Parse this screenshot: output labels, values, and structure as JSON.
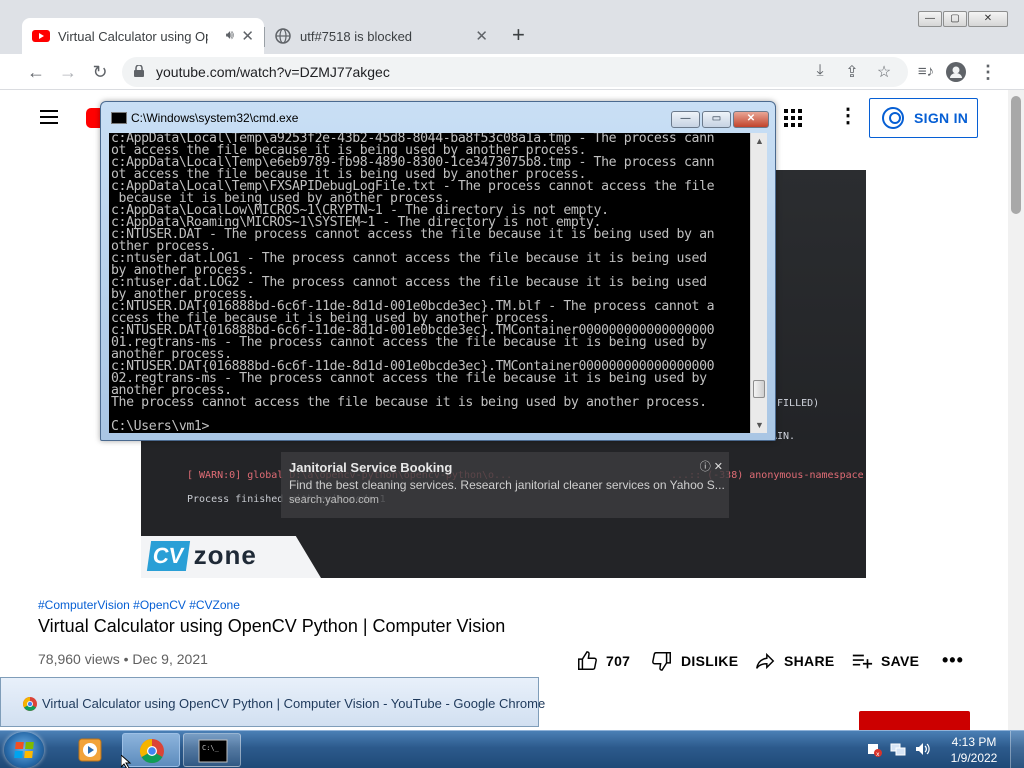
{
  "chrome": {
    "tabs": [
      {
        "title": "Virtual Calculator using Open",
        "favicon": "youtube-icon",
        "audio": "speaker-icon"
      },
      {
        "title": "utf#7518 is blocked",
        "favicon": "globe-icon"
      }
    ],
    "new_tab": "+",
    "window_buttons": {
      "minimize": "—",
      "maximize": "▢",
      "close": "✕"
    },
    "url": "youtube.com/watch?v=DZMJ77akgec"
  },
  "youtube": {
    "sign_in": "SIGN IN",
    "hashtags": "#ComputerVision #OpenCV #CVZone",
    "video_title": "Virtual Calculator using OpenCV Python | Computer Vision",
    "meta": "78,960 views • Dec 9, 2021",
    "actions": {
      "likes": "707",
      "dislike": "DISLIKE",
      "share": "SHARE",
      "save": "SAVE",
      "more": "•••"
    },
    "brand_color": "#ff0000",
    "player": {
      "code_right_1": ".FILLED)",
      "code_right_2": "AIN.",
      "warn_line": "[ WARN:0] global D:\\a\\opencv-python\\opencv-python\\o...",
      "warn_right": "...:: (-338)  anonymous-namespace'::S",
      "exit_line": "Process finished with exit code 1",
      "ad_title": "Janitorial Service Booking",
      "ad_desc": "Find the best cleaning services. Research janitorial cleaner services on Yahoo S...",
      "ad_url": "search.yahoo.com",
      "logo_cv": "CV",
      "logo_zone": "zone"
    }
  },
  "cmd": {
    "title": "C:\\Windows\\system32\\cmd.exe",
    "buttons": {
      "minimize": "—",
      "maximize": "▭",
      "close": "✕"
    },
    "output": "c:AppData\\Local\\Temp\\a9253f2e-43b2-45d8-8044-ba8f53c08a1a.tmp - The process cann\not access the file because it is being used by another process.\nc:AppData\\Local\\Temp\\e6eb9789-fb98-4890-8300-1ce3473075b8.tmp - The process cann\not access the file because it is being used by another process.\nc:AppData\\Local\\Temp\\FXSAPIDebugLogFile.txt - The process cannot access the file\n because it is being used by another process.\nc:AppData\\LocalLow\\MICROS~1\\CRYPTN~1 - The directory is not empty.\nc:AppData\\Roaming\\MICROS~1\\SYSTEM~1 - The directory is not empty.\nc:NTUSER.DAT - The process cannot access the file because it is being used by an\nother process.\nc:ntuser.dat.LOG1 - The process cannot access the file because it is being used\nby another process.\nc:ntuser.dat.LOG2 - The process cannot access the file because it is being used\nby another process.\nc:NTUSER.DAT{016888bd-6c6f-11de-8d1d-001e0bcde3ec}.TM.blf - The process cannot a\nccess the file because it is being used by another process.\nc:NTUSER.DAT{016888bd-6c6f-11de-8d1d-001e0bcde3ec}.TMContainer000000000000000000\n01.regtrans-ms - The process cannot access the file because it is being used by\nanother process.\nc:NTUSER.DAT{016888bd-6c6f-11de-8d1d-001e0bcde3ec}.TMContainer000000000000000000\n02.regtrans-ms - The process cannot access the file because it is being used by\nanother process.\nThe process cannot access the file because it is being used by another process.\n\nC:\\Users\\vm1>"
  },
  "taskbar": {
    "tooltip": "Virtual Calculator using OpenCV Python | Computer Vision - YouTube - Google Chrome",
    "time": "4:13 PM",
    "date": "1/9/2022"
  }
}
